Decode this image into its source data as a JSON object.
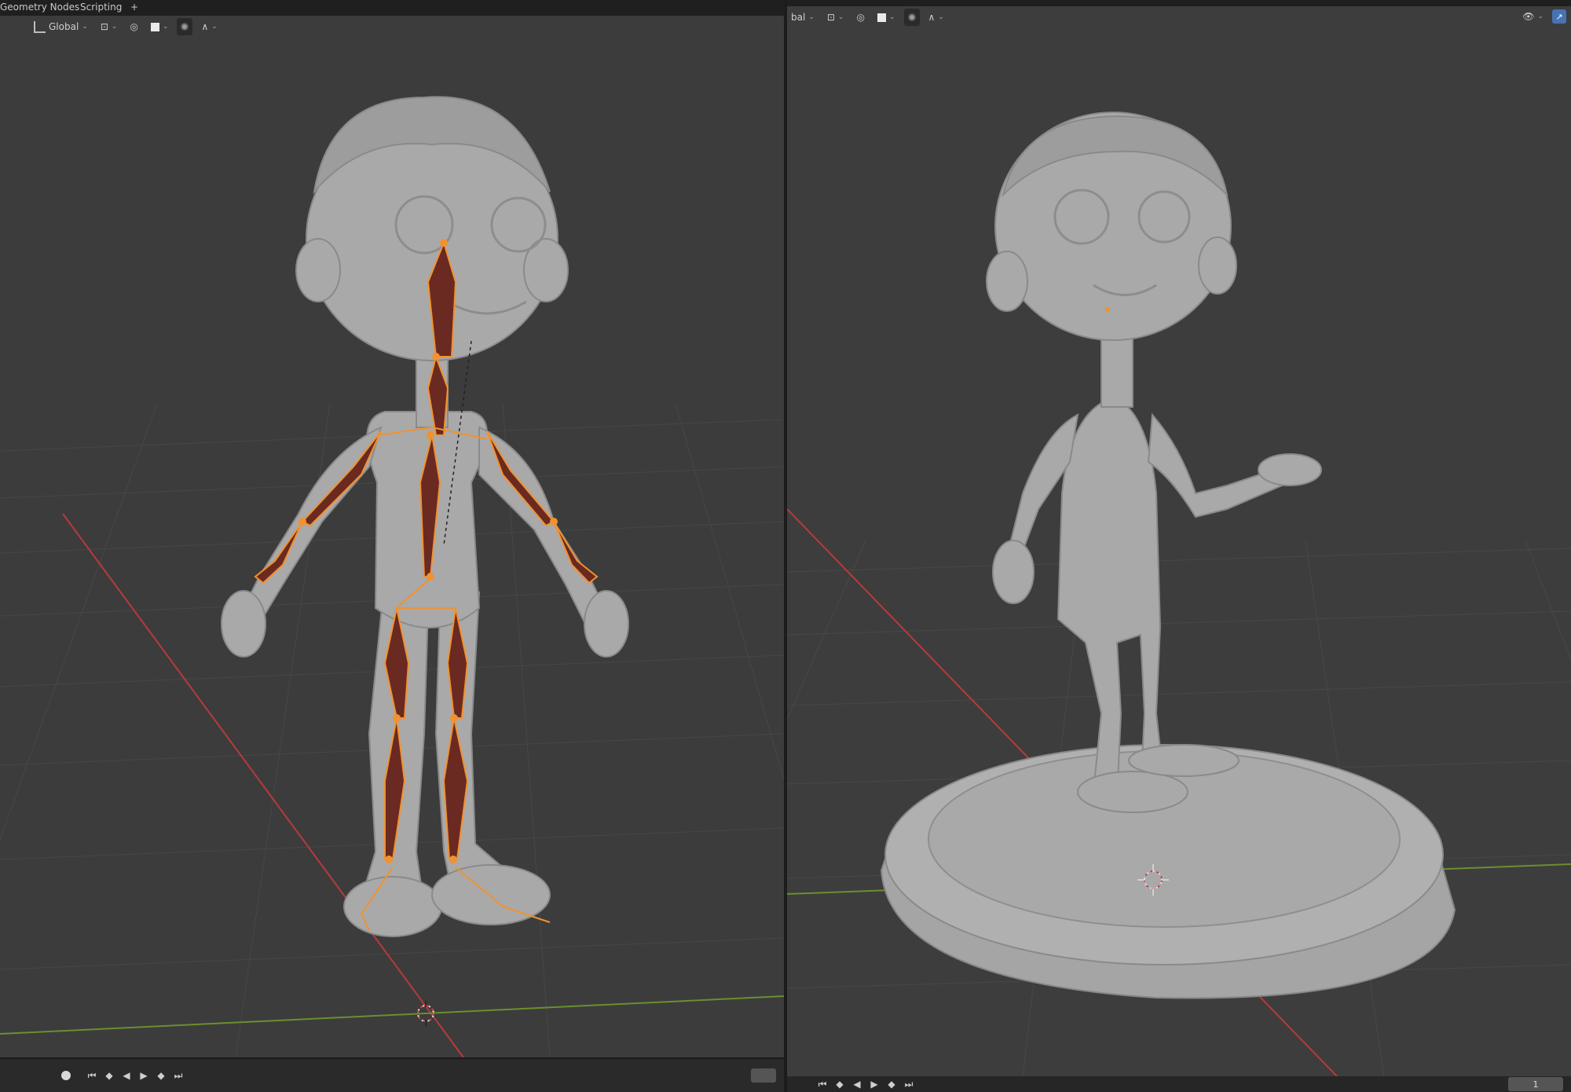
{
  "workspace_tabs": [
    {
      "label": "Geometry Nodes"
    },
    {
      "label": "Scripting"
    },
    {
      "label": "+"
    }
  ],
  "left_viewport": {
    "header": {
      "orientation_label": "Global"
    },
    "timeline": {}
  },
  "right_viewport": {
    "header": {
      "orientation_label": "bal"
    },
    "timeline": {
      "current_frame": "1"
    }
  },
  "colors": {
    "viewport_bg": "#3c3c3c",
    "grid_line": "#4a4a4a",
    "x_axis": "#b83a3a",
    "y_axis": "#6a8f2f",
    "armature_selected": "#f0922f",
    "bone_fill": "#6a2a22",
    "mesh": "#a8a8a8",
    "accent_blue": "#4772b3"
  },
  "icons": [
    "transform-orientation-icon",
    "snap-icon",
    "proportional-edit-icon",
    "viewport-shading-icon",
    "overlay-icon",
    "falloff-icon",
    "record-icon",
    "jump-start-icon",
    "keyframe-prev-icon",
    "play-reverse-icon",
    "play-icon",
    "keyframe-next-icon",
    "jump-end-icon",
    "visibility-eye-icon",
    "gizmo-toggle-icon",
    "3d-cursor-icon"
  ]
}
